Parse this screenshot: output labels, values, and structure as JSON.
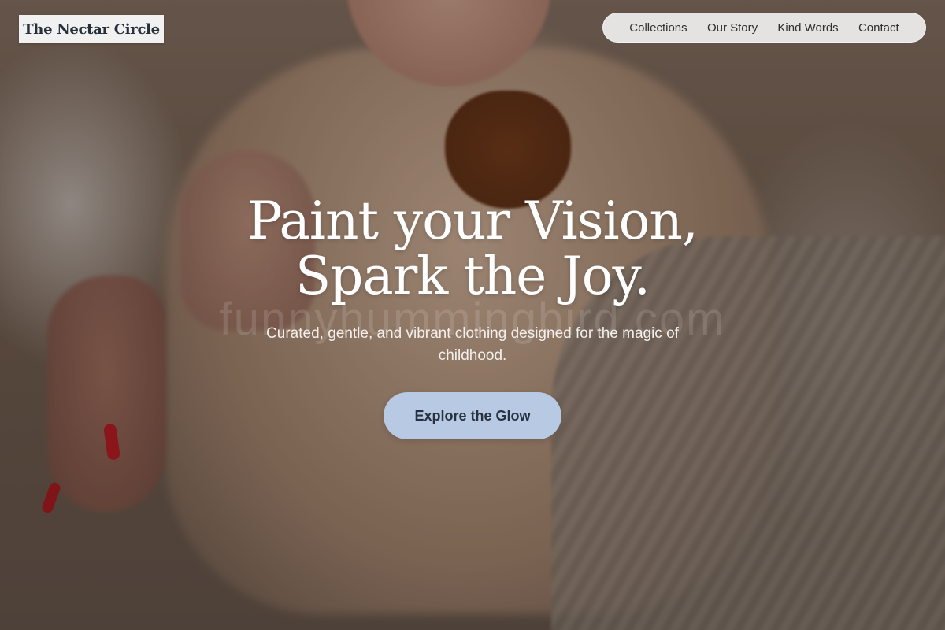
{
  "brand": {
    "name": "The Nectar Circle"
  },
  "nav": {
    "items": [
      {
        "label": "Collections"
      },
      {
        "label": "Our Story"
      },
      {
        "label": "Kind Words"
      },
      {
        "label": "Contact"
      }
    ]
  },
  "hero": {
    "title_line1": "Paint your Vision,",
    "title_line2": "Spark the Joy.",
    "subtitle": "Curated, gentle, and vibrant clothing designed for the magic of childhood.",
    "cta_label": "Explore the Glow",
    "watermark": "funnyhummingbird.com"
  },
  "colors": {
    "cta_background": "#b7c9e3",
    "logo_background": "#f1f1f1",
    "title_text": "#ffffff"
  }
}
